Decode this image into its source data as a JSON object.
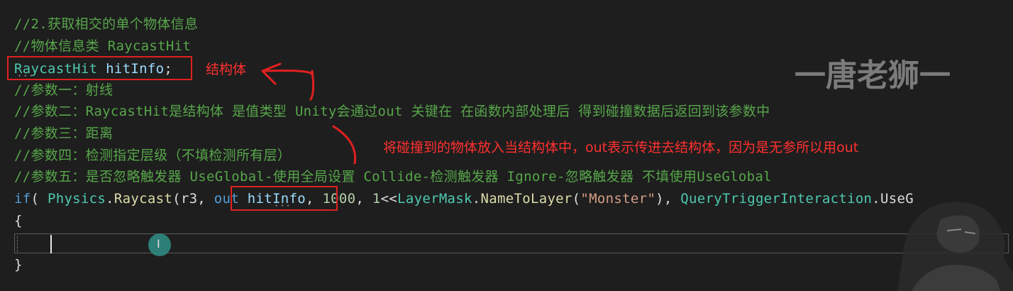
{
  "code": {
    "line1": "//2.获取相交的单个物体信息",
    "line2": "//物体信息类 RaycastHit",
    "line3_type": "RaycastHit",
    "line3_var": "hitInfo",
    "line3_end": ";",
    "line4": "//参数一：射线",
    "line5": "//参数二：RaycastHit是结构体 是值类型 Unity会通过out 关键在 在函数内部处理后 得到碰撞数据后返回到该参数中",
    "line6": "//参数三：距离",
    "line7": "//参数四：检测指定层级（不填检测所有层）",
    "line8": "//参数五：是否忽略触发器 UseGlobal-使用全局设置 Collide-检测触发器 Ignore-忽略触发器 不填使用UseGlobal",
    "line9": {
      "if": "if",
      "paren": "( ",
      "physics": "Physics",
      "dot1": ".",
      "raycast": "Raycast",
      "args1": "(r3, ",
      "out": "out",
      "space": " ",
      "hitinfo": "hitInfo",
      "comma1": ", ",
      "num1000": "1000",
      "comma2": ", ",
      "num1": "1",
      "shift": "<<",
      "layermask": "LayerMask",
      "dot2": ".",
      "nametolayer": "NameToLayer",
      "open": "(",
      "monster": "\"Monster\"",
      "close": "), ",
      "qti": "QueryTriggerInteraction",
      "dot3": ".",
      "useg": "UseG"
    },
    "line10": "{",
    "line12": "}"
  },
  "annotations": {
    "struct_note": "结构体",
    "out_note": "将碰撞到的物体放入当结构体中，out表示传进去结构体，因为是无参所以用out"
  },
  "watermark": "一唐老狮一",
  "colors": {
    "background": "#1e1e1e",
    "comment": "#57a64a",
    "type": "#4ec9b0",
    "keyword": "#569cd6",
    "string": "#d69d85",
    "annotation": "#ff3030"
  }
}
